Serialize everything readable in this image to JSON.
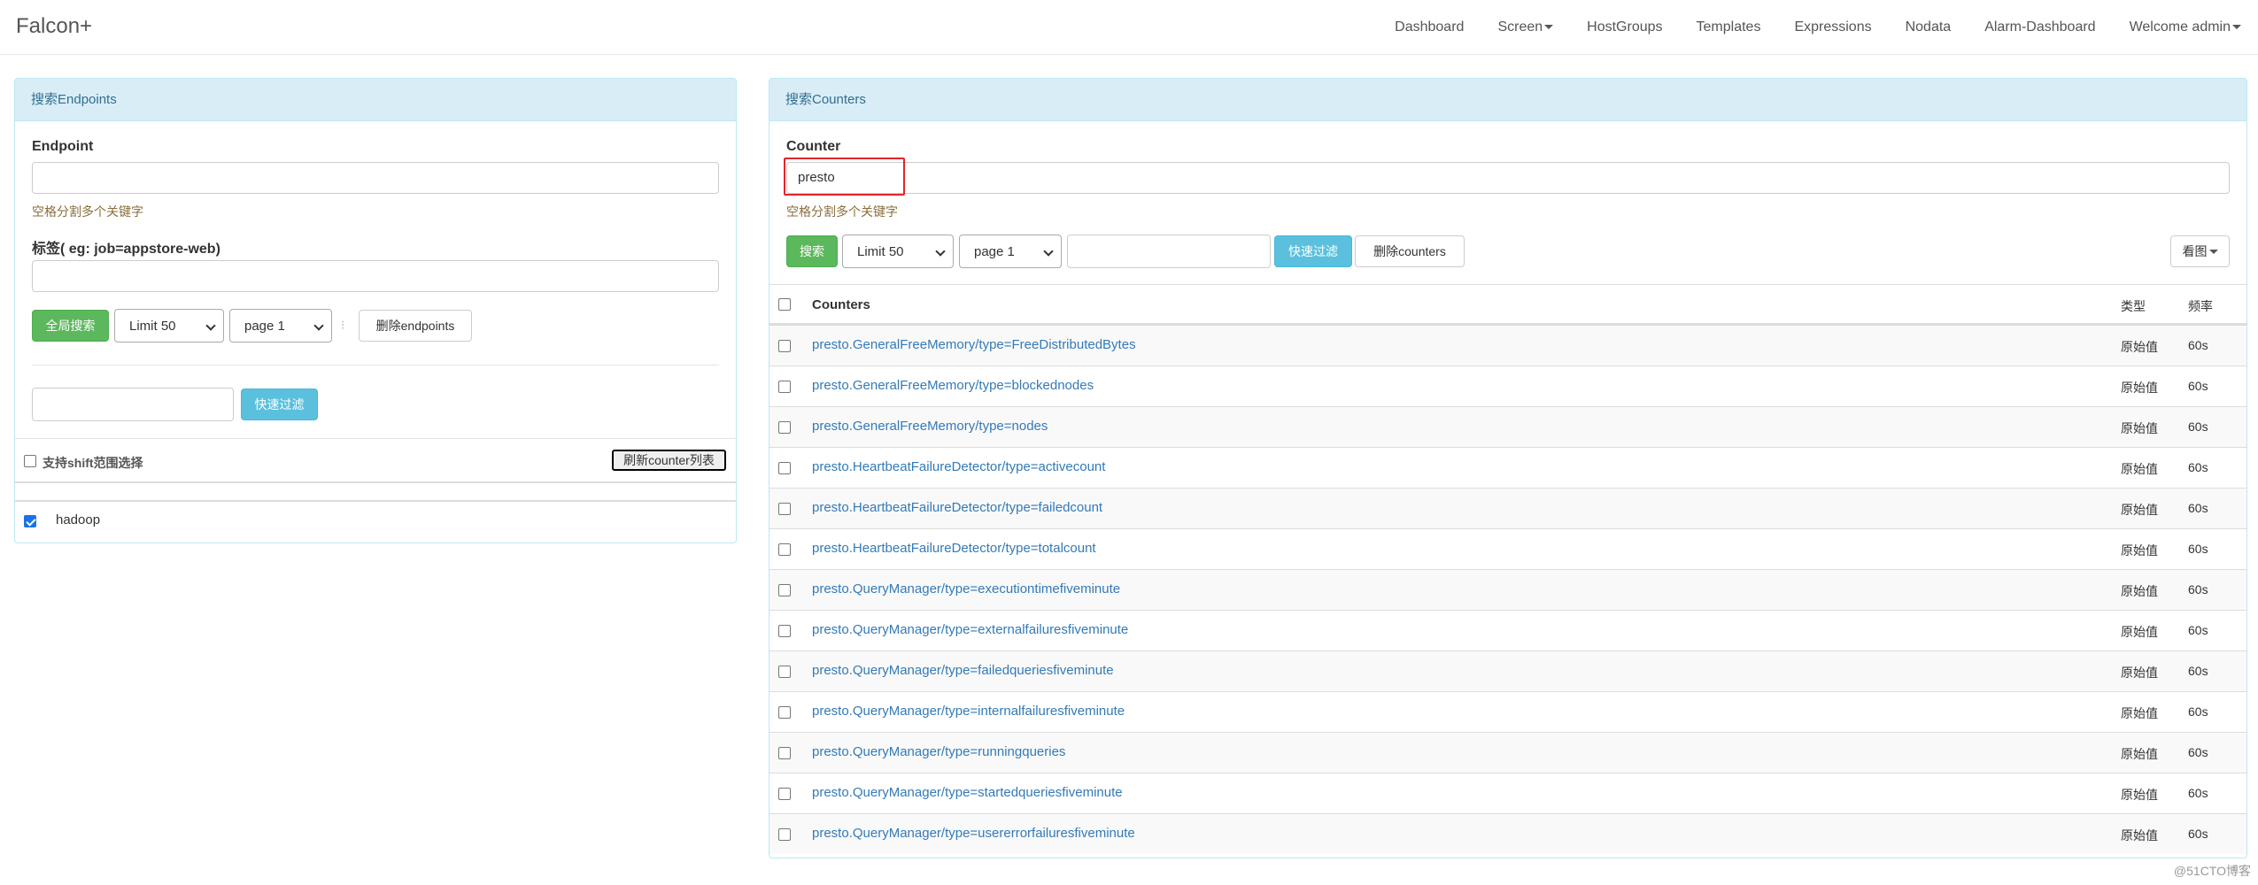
{
  "navbar": {
    "brand": "Falcon+",
    "items": [
      {
        "label": "Dashboard"
      },
      {
        "label": "Screen",
        "dropdown": true
      },
      {
        "label": "HostGroups"
      },
      {
        "label": "Templates"
      },
      {
        "label": "Expressions"
      },
      {
        "label": "Nodata"
      },
      {
        "label": "Alarm-Dashboard"
      },
      {
        "label": "Welcome admin",
        "dropdown": true
      }
    ]
  },
  "left": {
    "heading": "搜索Endpoints",
    "endpoint_label": "Endpoint",
    "endpoint_value": "",
    "endpoint_help": "空格分割多个关键字",
    "tag_label": "标签( eg: job=appstore-web)",
    "tag_value": "",
    "search_all_btn": "全局搜索",
    "limit_select": "Limit 50",
    "page_select": "page 1",
    "separator": "⁝",
    "delete_endpoints_btn": "删除endpoints",
    "filter_value": "",
    "quick_filter_btn": "快速过滤",
    "shift_select_label": "支持shift范围选择",
    "refresh_btn": "刷新counter列表",
    "endpoints": [
      {
        "name": "hadoop",
        "checked": true
      }
    ]
  },
  "right": {
    "heading": "搜索Counters",
    "counter_label": "Counter",
    "counter_value": "presto",
    "counter_help": "空格分割多个关键字",
    "search_btn": "搜索",
    "limit_select": "Limit 50",
    "page_select": "page 1",
    "filter_value": "",
    "quick_filter_btn": "快速过滤",
    "delete_counters_btn": "删除counters",
    "view_graph_btn": "看图",
    "columns": {
      "counters": "Counters",
      "type": "类型",
      "freq": "频率"
    },
    "rows": [
      {
        "counter": "presto.GeneralFreeMemory/type=FreeDistributedBytes",
        "type": "原始值",
        "freq": "60s"
      },
      {
        "counter": "presto.GeneralFreeMemory/type=blockednodes",
        "type": "原始值",
        "freq": "60s"
      },
      {
        "counter": "presto.GeneralFreeMemory/type=nodes",
        "type": "原始值",
        "freq": "60s"
      },
      {
        "counter": "presto.HeartbeatFailureDetector/type=activecount",
        "type": "原始值",
        "freq": "60s"
      },
      {
        "counter": "presto.HeartbeatFailureDetector/type=failedcount",
        "type": "原始值",
        "freq": "60s"
      },
      {
        "counter": "presto.HeartbeatFailureDetector/type=totalcount",
        "type": "原始值",
        "freq": "60s"
      },
      {
        "counter": "presto.QueryManager/type=executiontimefiveminute",
        "type": "原始值",
        "freq": "60s"
      },
      {
        "counter": "presto.QueryManager/type=externalfailuresfiveminute",
        "type": "原始值",
        "freq": "60s"
      },
      {
        "counter": "presto.QueryManager/type=failedqueriesfiveminute",
        "type": "原始值",
        "freq": "60s"
      },
      {
        "counter": "presto.QueryManager/type=internalfailuresfiveminute",
        "type": "原始值",
        "freq": "60s"
      },
      {
        "counter": "presto.QueryManager/type=runningqueries",
        "type": "原始值",
        "freq": "60s"
      },
      {
        "counter": "presto.QueryManager/type=startedqueriesfiveminute",
        "type": "原始值",
        "freq": "60s"
      },
      {
        "counter": "presto.QueryManager/type=usererrorfailuresfiveminute",
        "type": "原始值",
        "freq": "60s"
      }
    ]
  },
  "colors": {
    "panel_heading_bg": "#d9edf7",
    "panel_heading_text": "#31708f",
    "link": "#337ab7",
    "success": "#5cb85c",
    "info": "#5bc0de",
    "help_text": "#8a6d3b",
    "highlight_box": "#e0262b"
  },
  "watermark": "@51CTO博客"
}
